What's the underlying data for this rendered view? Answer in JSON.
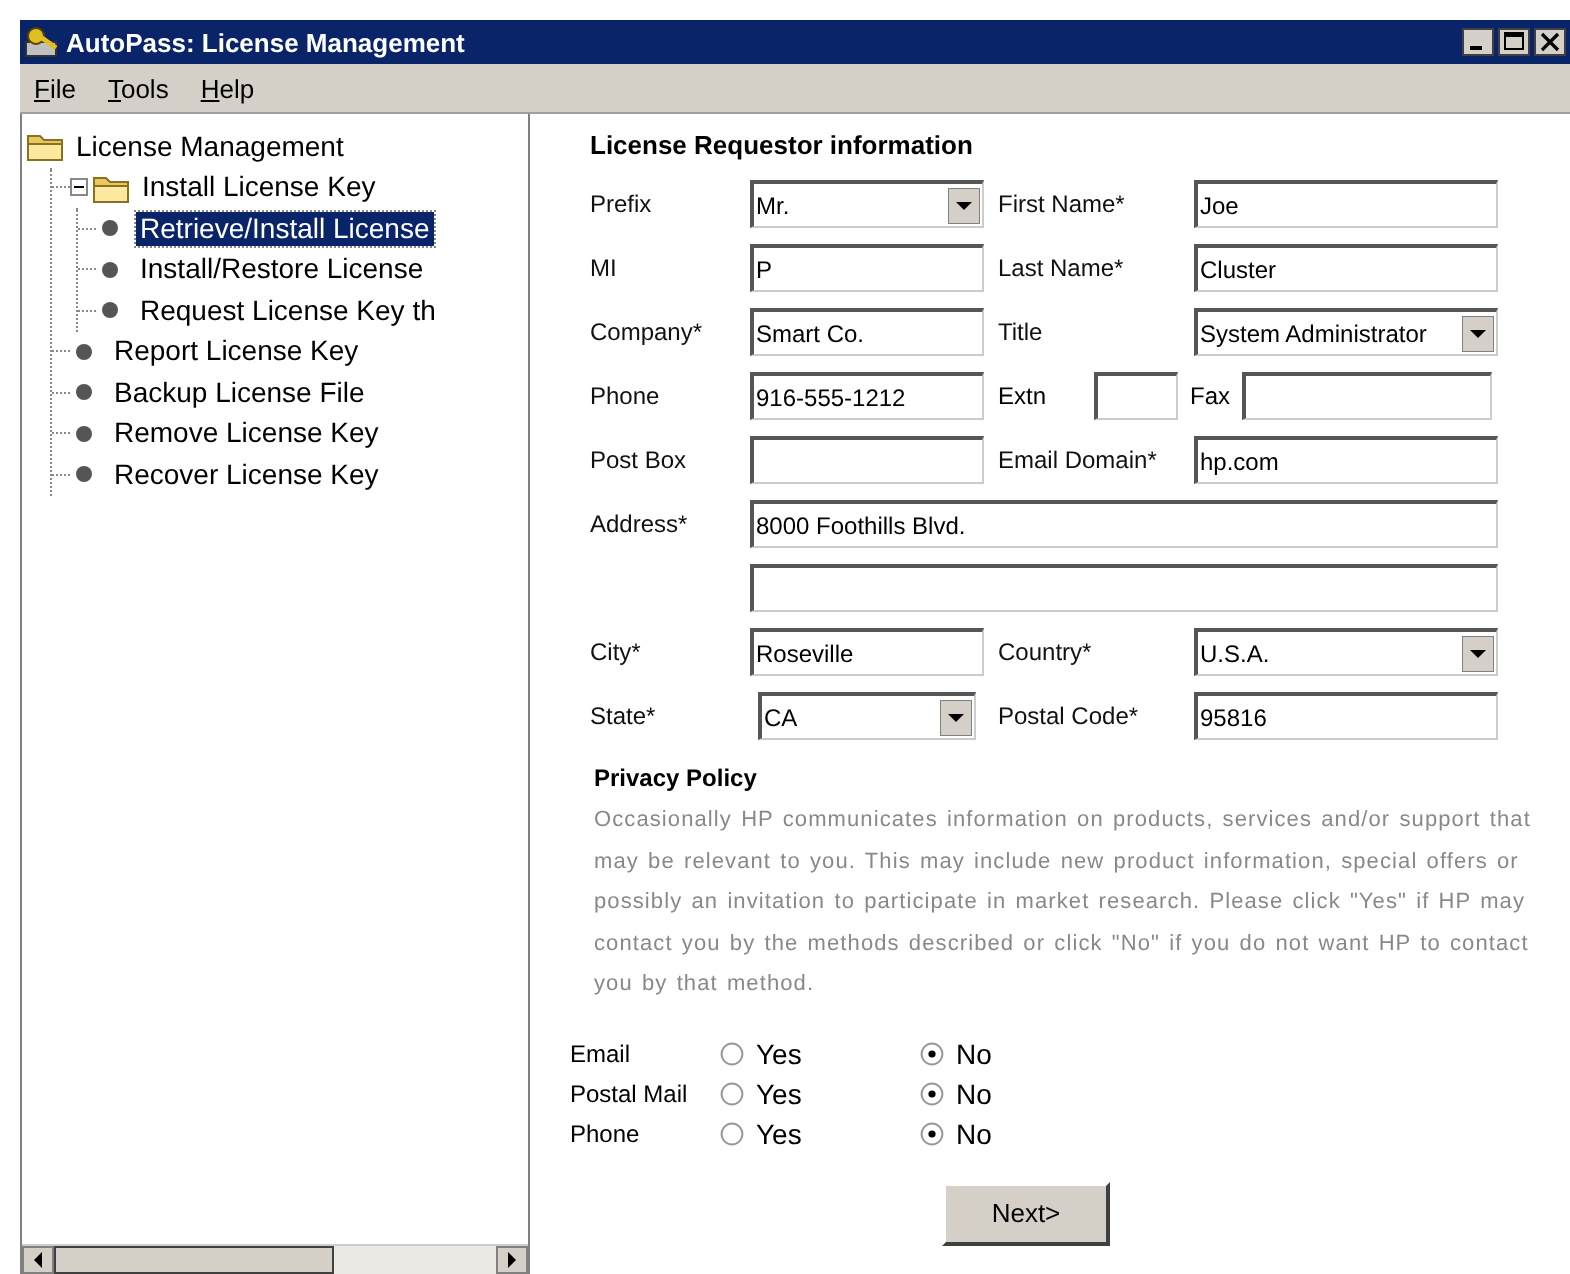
{
  "window": {
    "title": "AutoPass: License Management"
  },
  "menu": [
    {
      "label": "File"
    },
    {
      "label": "Tools"
    },
    {
      "label": "Help"
    }
  ],
  "tree": {
    "label": "License Management",
    "kind": "folder",
    "selected": false,
    "children": [
      {
        "label": "Install License Key",
        "kind": "folder",
        "selected": false,
        "expanded": true,
        "children": [
          {
            "label": "Retrieve/Install License",
            "kind": "leaf",
            "selected": true
          },
          {
            "label": "Install/Restore License",
            "kind": "leaf",
            "selected": false
          },
          {
            "label": "Request License Key th",
            "kind": "leaf",
            "selected": false
          }
        ]
      },
      {
        "label": "Report License Key",
        "kind": "leaf",
        "selected": false
      },
      {
        "label": "Backup License File",
        "kind": "leaf",
        "selected": false
      },
      {
        "label": "Remove License Key",
        "kind": "leaf",
        "selected": false
      },
      {
        "label": "Recover License Key",
        "kind": "leaf",
        "selected": false
      }
    ]
  },
  "form": {
    "heading": "License Requestor information",
    "rows": [
      [
        {
          "label": "Prefix",
          "kind": "select",
          "value": "Mr."
        },
        {
          "label": "First Name*",
          "kind": "text",
          "value": "Joe"
        }
      ],
      [
        {
          "label": "MI",
          "kind": "text",
          "value": "P"
        },
        {
          "label": "Last Name*",
          "kind": "text",
          "value": "Cluster"
        }
      ],
      [
        {
          "label": "Company*",
          "kind": "text",
          "value": "Smart Co."
        },
        {
          "label": "Title",
          "kind": "select",
          "value": "System Administrator"
        }
      ],
      [
        {
          "label": "Phone",
          "kind": "text",
          "value": "916-555-1212"
        },
        {
          "label": "Extn",
          "kind": "short"
        },
        {
          "label": "Fax",
          "kind": "short-wide"
        }
      ],
      [
        {
          "label": "Post Box",
          "kind": "text"
        },
        {
          "label": "Email Domain*",
          "kind": "text",
          "value": "hp.com"
        }
      ],
      [
        {
          "label": "Address*",
          "kind": "wide",
          "value": "8000 Foothills Blvd."
        }
      ],
      [
        {
          "kind": "wide"
        }
      ],
      [
        {
          "label": "City*",
          "kind": "text",
          "value": "Roseville"
        },
        {
          "label": "Country*",
          "kind": "select",
          "value": "U.S.A."
        }
      ],
      [
        {
          "label": "State*",
          "kind": "select",
          "value": "CA"
        },
        {
          "label": "Postal Code*",
          "kind": "text",
          "value": "95816"
        }
      ]
    ]
  },
  "privacy": {
    "heading": "Privacy Policy",
    "text": "Occasionally HP communicates information on products, services and/or support that may be relevant to you. This may include new product information, special offers or possibly an invitation to participate in market research.  Please click \"Yes\" if HP may contact you by the methods described or click \"No\" if you do not want HP to contact you by that method.",
    "contacts": [
      {
        "label": "Email",
        "options": [
          {
            "label": "Yes",
            "selected": false
          },
          {
            "label": "No",
            "selected": true
          }
        ]
      },
      {
        "label": "Postal Mail",
        "options": [
          {
            "label": "Yes",
            "selected": false
          },
          {
            "label": "No",
            "selected": true
          }
        ]
      },
      {
        "label": "Phone",
        "options": [
          {
            "label": "Yes",
            "selected": false
          },
          {
            "label": "No",
            "selected": true
          }
        ]
      }
    ]
  },
  "buttons": [
    {
      "label": "Next>"
    }
  ]
}
